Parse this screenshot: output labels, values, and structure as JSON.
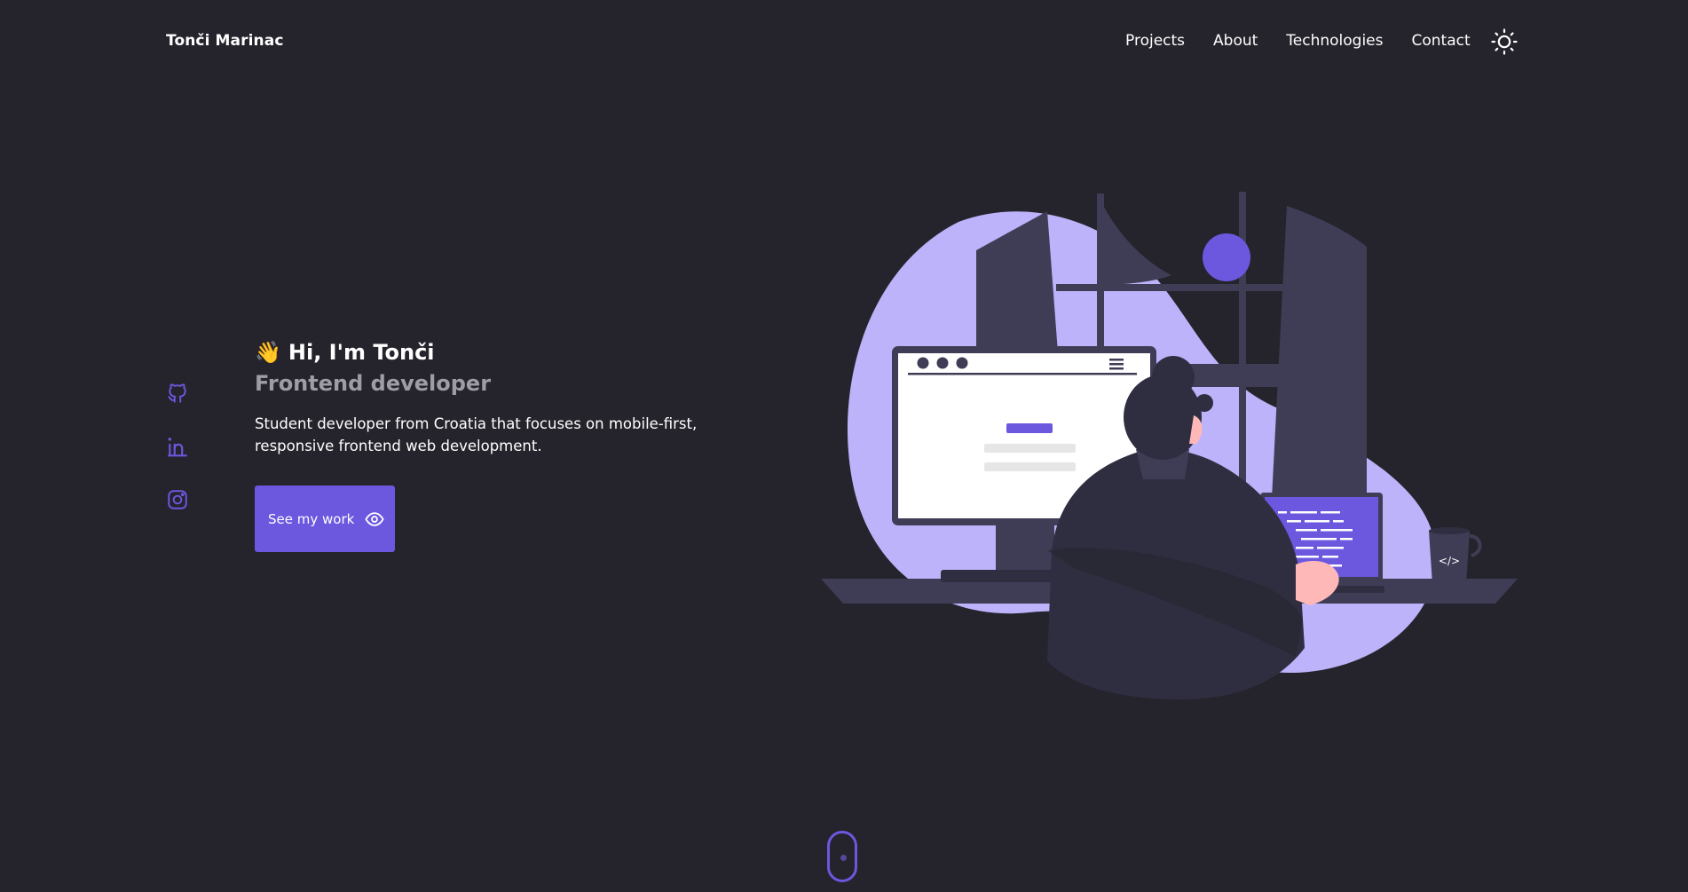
{
  "header": {
    "brand": "Tonči Marinac",
    "nav": [
      "Projects",
      "About",
      "Technologies",
      "Contact"
    ],
    "theme_toggle_icon": "sun-icon"
  },
  "socials": [
    {
      "icon": "github-icon"
    },
    {
      "icon": "linkedin-icon"
    },
    {
      "icon": "instagram-icon"
    }
  ],
  "hero": {
    "wave_emoji": "👋",
    "greeting": "Hi, I'm Tonči",
    "role": "Frontend developer",
    "description": "Student developer from Croatia that focuses on mobile-first, responsive frontend web development.",
    "cta_label": "See my work",
    "cta_icon": "eye-icon"
  },
  "illustration": {
    "icon": "developer-at-desk-illustration",
    "mug_label": "</>"
  },
  "scroll_indicator": {
    "icon": "mouse-scroll-icon"
  },
  "colors": {
    "background": "#25242c",
    "accent": "#6c57df",
    "blob": "#bdb3fa",
    "muted_text": "#9e9da6"
  }
}
